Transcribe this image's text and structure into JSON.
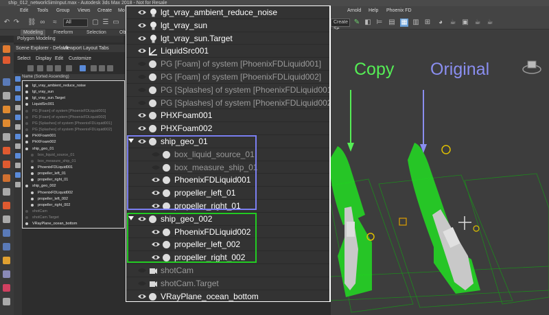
{
  "window": {
    "title": "ship_012_networkSimInput.max - Autodesk 3ds Max 2018 - Not for Resale"
  },
  "menu": [
    "Edit",
    "Tools",
    "Group",
    "Views",
    "Create",
    "Mo",
    "Arnold",
    "Help",
    "Phoenix FD"
  ],
  "toolbar": {
    "selection_filter": "All",
    "named_set": "Create Se"
  },
  "ribbon": {
    "tabs": [
      "Modeling",
      "Freeform",
      "Selection",
      "Ob"
    ],
    "sub_tab": "Polygon Modeling"
  },
  "scene_explorer": {
    "tabs": [
      "Scene Explorer - Default",
      "Viewport Layout Tabs"
    ],
    "menu": [
      "Select",
      "Display",
      "Edit",
      "Customize"
    ],
    "header": "Name (Sorted Ascending)",
    "rows": [
      {
        "label": "lgt_vray_ambient_reduce_noise",
        "dim": false
      },
      {
        "label": "lgt_vray_sun",
        "dim": false
      },
      {
        "label": "lgt_vray_sun.Target",
        "dim": false
      },
      {
        "label": "LiquidSrc001",
        "dim": false
      },
      {
        "label": "PG [Foam] of system [PhoenixFDLiquid001]",
        "dim": true
      },
      {
        "label": "PG [Foam] of system [PhoenixFDLiquid002]",
        "dim": true
      },
      {
        "label": "PG [Splashes] of system [PhoenixFDLiquid001]",
        "dim": true
      },
      {
        "label": "PG [Splashes] of system [PhoenixFDLiquid002]",
        "dim": true
      },
      {
        "label": "PHXFoam001",
        "dim": false
      },
      {
        "label": "PHXFoam002",
        "dim": false
      },
      {
        "label": "ship_geo_01",
        "dim": false
      },
      {
        "label": "box_liquid_source_01",
        "dim": true
      },
      {
        "label": "box_measure_ship_01",
        "dim": true
      },
      {
        "label": "PhoenixFDLiquid001",
        "dim": false
      },
      {
        "label": "propeller_left_01",
        "dim": false
      },
      {
        "label": "propeller_right_01",
        "dim": false
      },
      {
        "label": "ship_geo_002",
        "dim": false
      },
      {
        "label": "PhoenixFDLiquid002",
        "dim": false
      },
      {
        "label": "propeller_left_002",
        "dim": false
      },
      {
        "label": "propeller_right_002",
        "dim": false
      },
      {
        "label": "shotCam",
        "dim": true
      },
      {
        "label": "shotCam.Target",
        "dim": true
      },
      {
        "label": "VRayPlane_ocean_bottom",
        "dim": false
      }
    ]
  },
  "outliner_zoom": {
    "rows": [
      {
        "label": "lgt_vray_ambient_reduce_noise",
        "dim": false,
        "indent": 0,
        "kind": "light",
        "visible": true
      },
      {
        "label": "lgt_vray_sun",
        "dim": false,
        "indent": 0,
        "kind": "light",
        "visible": true
      },
      {
        "label": "lgt_vray_sun.Target",
        "dim": false,
        "indent": 0,
        "kind": "light",
        "visible": true
      },
      {
        "label": "LiquidSrc001",
        "dim": false,
        "indent": 0,
        "kind": "source",
        "visible": true
      },
      {
        "label": "PG [Foam] of system [PhoenixFDLiquid001]",
        "dim": true,
        "indent": 0,
        "kind": "object",
        "visible": false
      },
      {
        "label": "PG [Foam] of system [PhoenixFDLiquid002]",
        "dim": true,
        "indent": 0,
        "kind": "object",
        "visible": false
      },
      {
        "label": "PG [Splashes] of system [PhoenixFDLiquid001]",
        "dim": true,
        "indent": 0,
        "kind": "object",
        "visible": false
      },
      {
        "label": "PG [Splashes] of system [PhoenixFDLiquid002]",
        "dim": true,
        "indent": 0,
        "kind": "object",
        "visible": false
      },
      {
        "label": "PHXFoam001",
        "dim": false,
        "indent": 0,
        "kind": "object",
        "visible": true
      },
      {
        "label": "PHXFoam002",
        "dim": false,
        "indent": 0,
        "kind": "object",
        "visible": true
      },
      {
        "label": "ship_geo_01",
        "dim": false,
        "indent": 0,
        "kind": "object",
        "visible": true,
        "expanded": true
      },
      {
        "label": "box_liquid_source_01",
        "dim": true,
        "indent": 1,
        "kind": "object",
        "visible": false
      },
      {
        "label": "box_measure_ship_01",
        "dim": true,
        "indent": 1,
        "kind": "object",
        "visible": false
      },
      {
        "label": "PhoenixFDLiquid001",
        "dim": false,
        "indent": 1,
        "kind": "object",
        "visible": true
      },
      {
        "label": "propeller_left_01",
        "dim": false,
        "indent": 1,
        "kind": "object",
        "visible": true
      },
      {
        "label": "propeller_right_01",
        "dim": false,
        "indent": 1,
        "kind": "object",
        "visible": true
      },
      {
        "label": "ship_geo_002",
        "dim": false,
        "indent": 0,
        "kind": "object",
        "visible": true,
        "expanded": true
      },
      {
        "label": "PhoenixFDLiquid002",
        "dim": false,
        "indent": 1,
        "kind": "object",
        "visible": true
      },
      {
        "label": "propeller_left_002",
        "dim": false,
        "indent": 1,
        "kind": "object",
        "visible": true
      },
      {
        "label": "propeller_right_002",
        "dim": false,
        "indent": 1,
        "kind": "object",
        "visible": true
      },
      {
        "label": "shotCam",
        "dim": true,
        "indent": 0,
        "kind": "camera",
        "visible": false
      },
      {
        "label": "shotCam.Target",
        "dim": true,
        "indent": 0,
        "kind": "camera",
        "visible": false
      },
      {
        "label": "VRayPlane_ocean_bottom",
        "dim": false,
        "indent": 0,
        "kind": "object",
        "visible": true
      }
    ]
  },
  "viewport": {
    "label_copy": "Copy",
    "label_original": "Original",
    "copy_color": "#55ee55",
    "original_color": "#8a8ef0"
  },
  "highlight": {
    "blue": "#7b7ff2",
    "green": "#22cc22"
  }
}
